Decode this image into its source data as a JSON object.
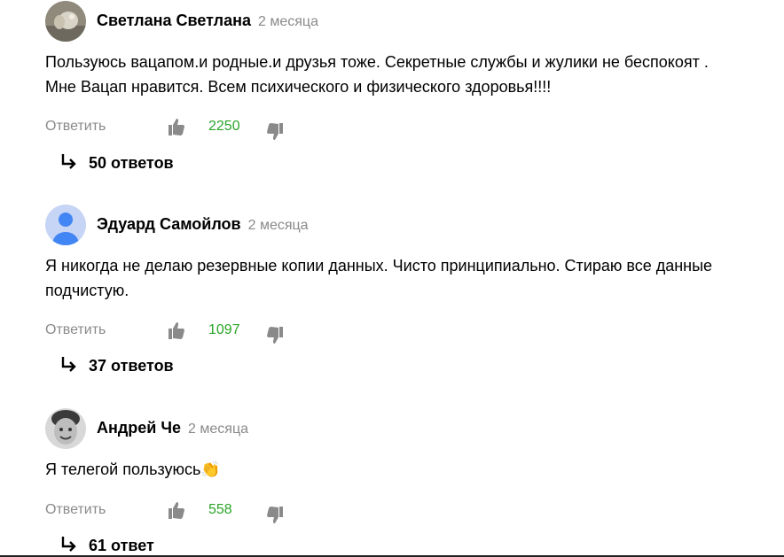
{
  "comments": [
    {
      "author": "Светлана Светлана",
      "date": "2 месяца",
      "avatar": "photo-avatar-grey",
      "text": "Пользуюсь вацапом.и родные.и друзья тоже. Секретные службы и жулики не беспокоят . Мне Вацап нравится. Всем психического и физического здоровья!!!!",
      "reply_label": "Ответить",
      "likes": "2250",
      "replies_label": "50 ответов"
    },
    {
      "author": "Эдуард Самойлов",
      "date": "2 месяца",
      "avatar": "default-user-avatar",
      "text": "Я никогда не делаю резервные копии данных. Чисто принципиально. Стираю все данные подчистую.",
      "reply_label": "Ответить",
      "likes": "1097",
      "replies_label": "37 ответов"
    },
    {
      "author": "Андрей Че",
      "date": "2 месяца",
      "avatar": "photo-avatar-child",
      "text": "Я телегой пользуюсь👏",
      "reply_label": "Ответить",
      "likes": "558",
      "replies_label": "61 ответ"
    }
  ],
  "colors": {
    "like_count": "#2aa52a",
    "muted": "#8a8a8a",
    "icon": "#8a8a8a",
    "default_avatar_bg": "#c6d5f5",
    "default_avatar_fg": "#4285f4"
  },
  "icons": {
    "like": "thumbs-up-icon",
    "dislike": "thumbs-down-icon",
    "replies": "reply-arrow-icon"
  }
}
